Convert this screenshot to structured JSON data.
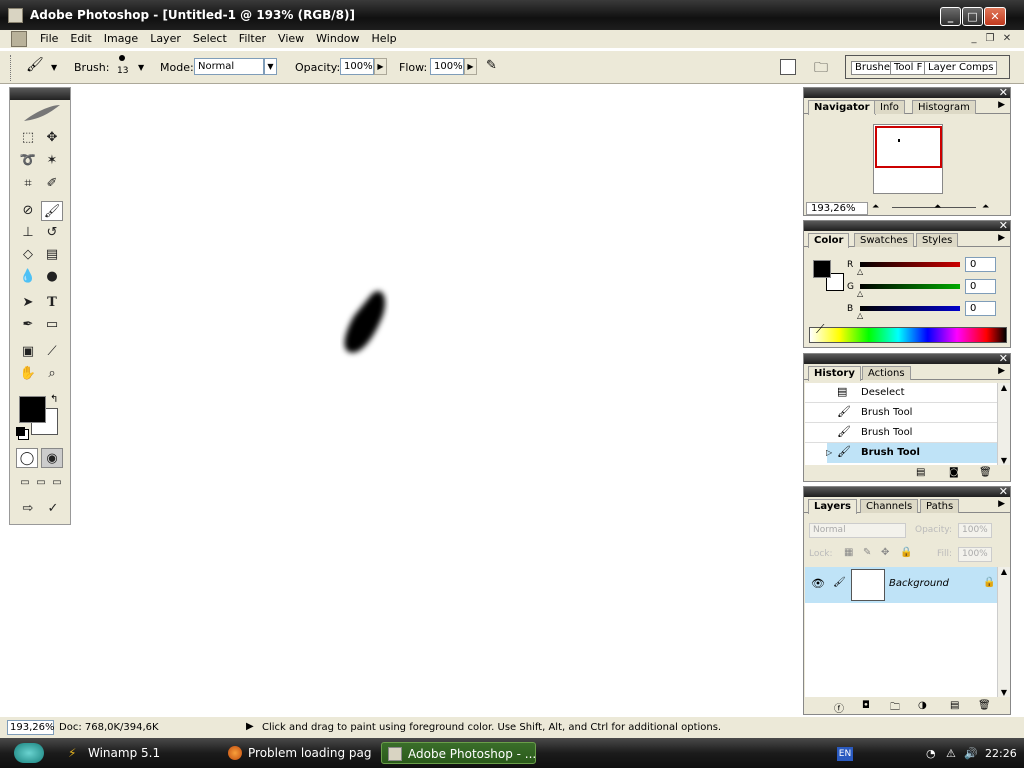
{
  "window": {
    "title": "Adobe Photoshop - [Untitled-1 @ 193% (RGB/8)]"
  },
  "menu": [
    "File",
    "Edit",
    "Image",
    "Layer",
    "Select",
    "Filter",
    "View",
    "Window",
    "Help"
  ],
  "options": {
    "brush_label": "Brush:",
    "brush_size": "13",
    "mode_label": "Mode:",
    "mode_value": "Normal",
    "opacity_label": "Opacity:",
    "opacity_value": "100%",
    "flow_label": "Flow:",
    "flow_value": "100%"
  },
  "palette_well": [
    "Brushe",
    "Tool F",
    "Layer Comps"
  ],
  "navigator": {
    "tabs": [
      "Navigator",
      "Info",
      "Histogram"
    ],
    "zoom": "193,26%"
  },
  "color": {
    "tabs": [
      "Color",
      "Swatches",
      "Styles"
    ],
    "channels": [
      {
        "label": "R",
        "value": "0",
        "color": "#cc0000"
      },
      {
        "label": "G",
        "value": "0",
        "color": "#00aa00"
      },
      {
        "label": "B",
        "value": "0",
        "color": "#0000cc"
      }
    ]
  },
  "history": {
    "tabs": [
      "History",
      "Actions"
    ],
    "items": [
      "Deselect",
      "Brush Tool",
      "Brush Tool",
      "Brush Tool"
    ]
  },
  "layers": {
    "tabs": [
      "Layers",
      "Channels",
      "Paths"
    ],
    "blend_mode": "Normal",
    "opacity_label": "Opacity:",
    "opacity_value": "100%",
    "lock_label": "Lock:",
    "fill_label": "Fill:",
    "fill_value": "100%",
    "layer_name": "Background"
  },
  "status": {
    "zoom": "193,26%",
    "doc": "Doc: 768,0K/394,6K",
    "hint": "Click and drag to paint using foreground color.  Use Shift, Alt, and Ctrl for additional options."
  },
  "taskbar": {
    "buttons": [
      "Winamp 5.1",
      "Problem loading pag...",
      "Adobe Photoshop - ..."
    ],
    "lang": "EN",
    "clock": "22:26"
  },
  "colors": {
    "selection": "#bfe3f7",
    "accent": "#cc0000"
  }
}
